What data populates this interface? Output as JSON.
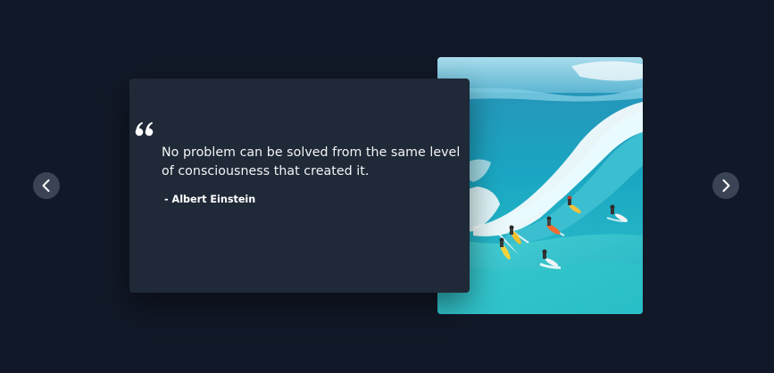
{
  "testimonial": {
    "quote": "No problem can be solved from the same level of consciousness that created it.",
    "author": "- Albert Einstein",
    "quote_icon": "quote-icon"
  },
  "navigation": {
    "prev_icon": "chevron-left-icon",
    "next_icon": "chevron-right-icon"
  },
  "image": {
    "subject": "surfers riding a turquoise ocean wave"
  },
  "colors": {
    "page_background": "#111827",
    "card_background": "#1f2937",
    "nav_button": "#3a4455",
    "text": "#f3f4f6"
  }
}
